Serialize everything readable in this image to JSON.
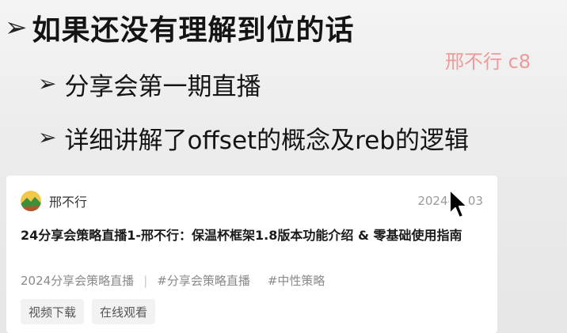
{
  "slide": {
    "bullets": [
      {
        "text": "如果还没有理解到位的话"
      },
      {
        "text": "分享会第一期直播"
      },
      {
        "text": "详细讲解了offset的概念及reb的逻辑"
      }
    ],
    "arrow_glyph": "➢",
    "watermark": "邢不行 c8"
  },
  "card": {
    "author": "邢不行",
    "date": "2024-",
    "date_tail": "03",
    "title": "24分享会策略直播1-邢不行：保温杯框架1.8版本功能介绍 & 零基础使用指南",
    "tags": [
      "2024分享会策略直播",
      "#分享会策略直播",
      "#中性策略"
    ],
    "tag_separator": "|",
    "actions": [
      "视频下载",
      "在线观看"
    ],
    "avatar_icon": "landscape-avatar-icon"
  },
  "cursor": {
    "icon": "mouse-pointer-icon"
  },
  "colors": {
    "watermark": "#ef9a9a",
    "text_main": "#141414",
    "tag_text": "#8a8a8a",
    "button_bg": "#f2f2f2"
  }
}
